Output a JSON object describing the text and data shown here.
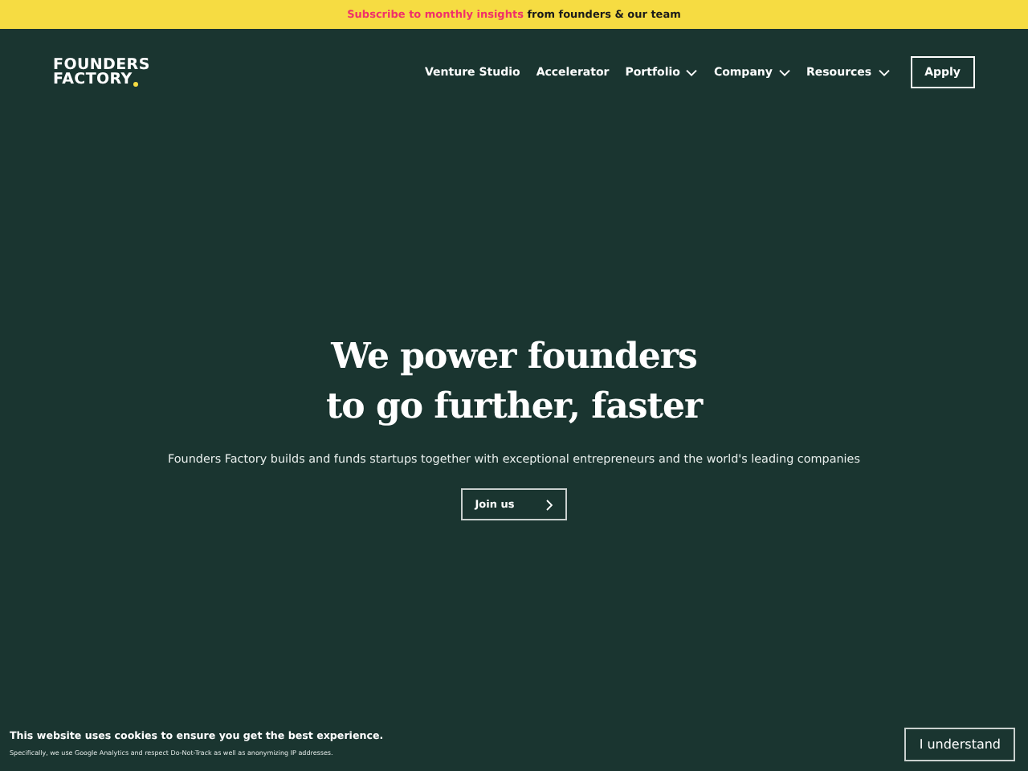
{
  "banner": {
    "link": "Subscribe to monthly insights",
    "text": " from founders & our team"
  },
  "logo": {
    "lines": [
      "FOUNDERS",
      "FACTORY"
    ]
  },
  "nav": [
    {
      "label": "Venture Studio",
      "has_menu": false
    },
    {
      "label": "Accelerator",
      "has_menu": false
    },
    {
      "label": "Portfolio",
      "has_menu": true
    },
    {
      "label": "Company",
      "has_menu": true
    },
    {
      "label": "Resources",
      "has_menu": true
    }
  ],
  "apply_button": "Apply",
  "hero": {
    "headline": [
      "We power founders",
      "to go further, faster"
    ],
    "subtitle": "Founders Factory builds and funds startups together with exceptional entrepreneurs and the world's leading companies",
    "button": "Join us"
  },
  "cookie": {
    "title": "This website uses cookies to ensure you get the best experience.",
    "detail": "Specifically, we use Google Analytics and respect Do-Not-Track as well as anonymizing IP addresses.",
    "button": "I understand"
  }
}
